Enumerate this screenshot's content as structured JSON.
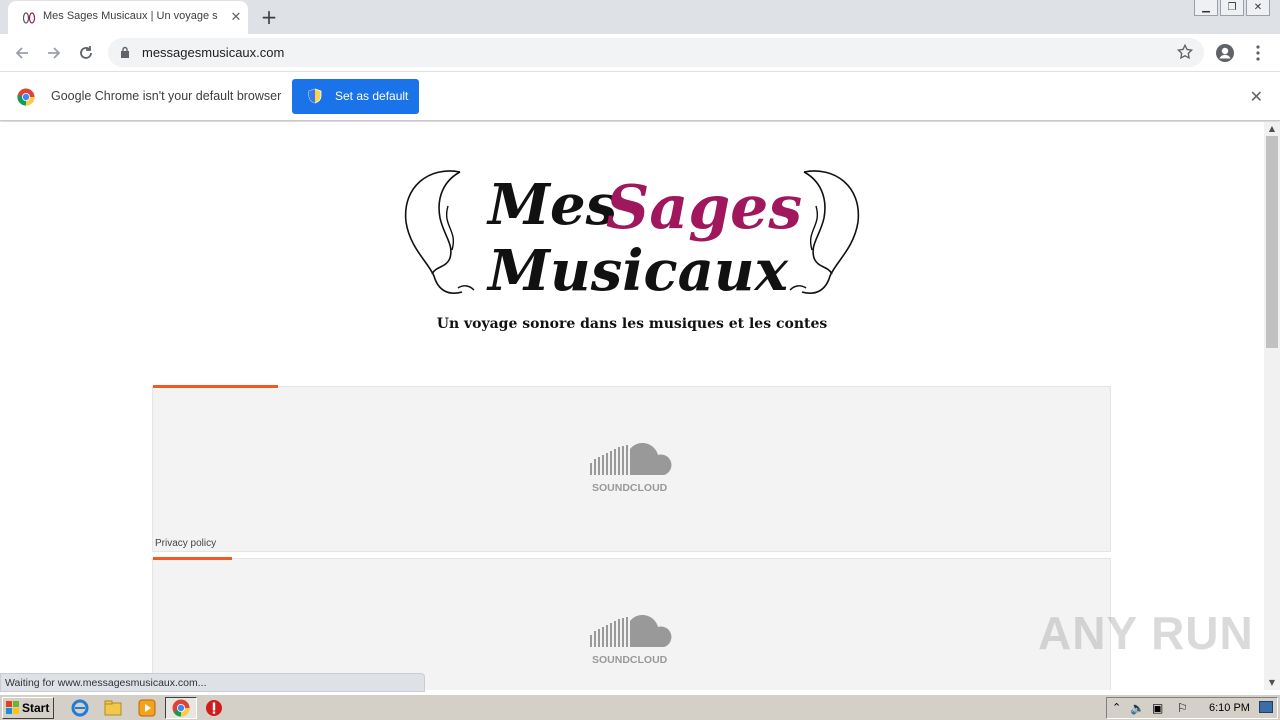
{
  "browser": {
    "tab_title": "Mes Sages Musicaux | Un voyage sonore dans les musiques et les contes",
    "url": "messagesmusicaux.com",
    "infobar_text": "Google Chrome isn't your default browser",
    "set_default_label": "Set as default",
    "status_text": "Waiting for www.messagesmusicaux.com..."
  },
  "site": {
    "logo_line1_a": "Mes",
    "logo_line1_b": "Sages",
    "logo_line2": "Musicaux",
    "tagline": "Un voyage sonore dans les musiques et les contes",
    "accent_color": "#a0175e"
  },
  "embeds": [
    {
      "brand": "SOUNDCLOUD",
      "privacy": "Privacy policy",
      "progress_fraction": 0.13
    },
    {
      "brand": "SOUNDCLOUD",
      "privacy": "",
      "progress_fraction": 0.083
    }
  ],
  "watermark": "ANY RUN",
  "taskbar": {
    "start_label": "Start",
    "clock": "6:10 PM"
  }
}
